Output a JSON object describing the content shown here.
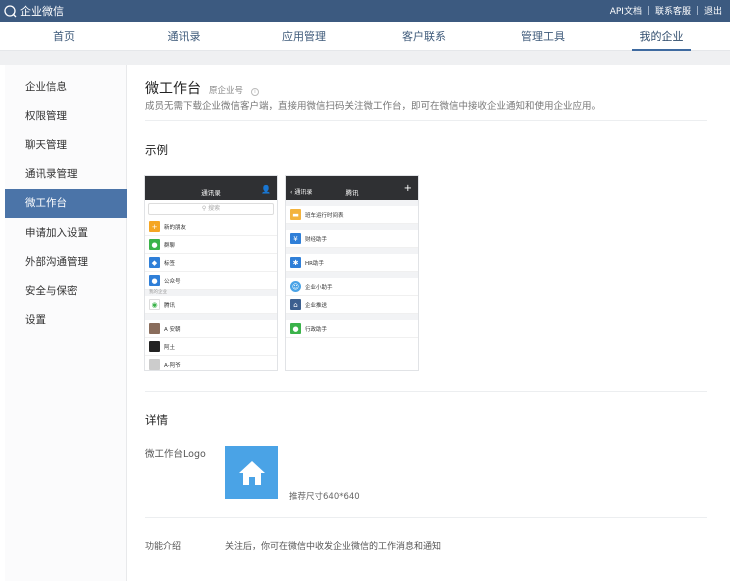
{
  "topbar": {
    "brand": "企业微信",
    "links": [
      "API文档",
      "联系客服",
      "退出"
    ]
  },
  "nav": {
    "tabs": [
      "首页",
      "通讯录",
      "应用管理",
      "客户联系",
      "管理工具",
      "我的企业"
    ],
    "active": "我的企业"
  },
  "sidebar": {
    "items": [
      "企业信息",
      "权限管理",
      "聊天管理",
      "通讯录管理",
      "微工作台",
      "申请加入设置",
      "外部沟通管理",
      "安全与保密",
      "设置"
    ],
    "active": "微工作台"
  },
  "content": {
    "title": "微工作台",
    "subtitle": "原企业号",
    "description": "成员无需下载企业微信客户端，直接用微信扫码关注微工作台，即可在微信中接收企业通知和使用企业应用。",
    "example_heading": "示例",
    "details_heading": "详情",
    "logo_label": "微工作台Logo",
    "logo_size": "推荐尺寸640*640",
    "feature_label": "功能介绍",
    "feature_value": "关注后，你可在微信中收发企业微信的工作消息和通知"
  },
  "phone1": {
    "title": "通讯录",
    "search": "搜索",
    "rows": [
      "新的朋友",
      "群聊",
      "标签",
      "公众号"
    ],
    "group_label": "我的企业",
    "company": "腾讯",
    "contacts": [
      "A 安朝",
      "阿土",
      "A-阿爷"
    ]
  },
  "phone2": {
    "back": "通讯录",
    "title": "腾讯",
    "plus": "+",
    "rows": [
      "班车运行时间表",
      "财经助手",
      "HR助手",
      "企业小助手",
      "企业推送",
      "行政助手"
    ]
  },
  "colors": {
    "topbar": "#3c5a80",
    "active_sidebar": "#4b74a8",
    "logo_bg": "#4aa3e6"
  }
}
